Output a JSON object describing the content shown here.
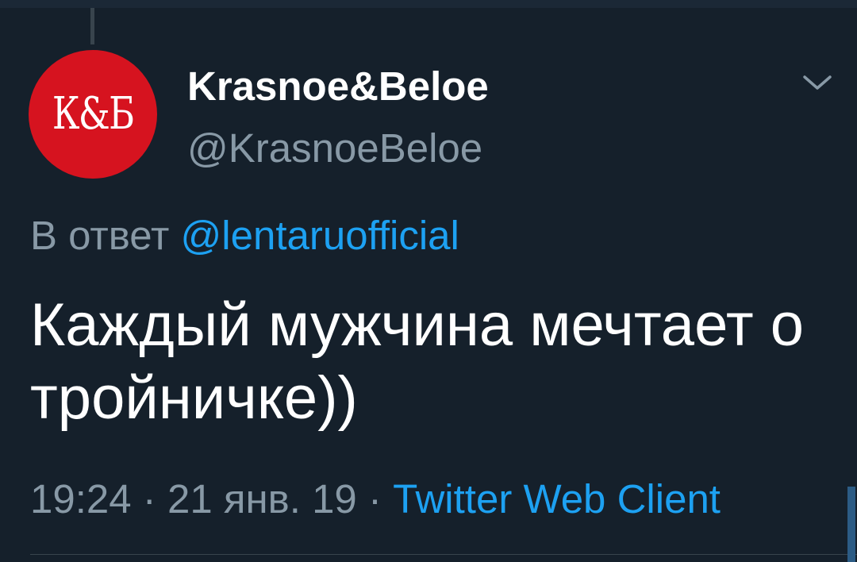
{
  "avatar": {
    "logo_text": "К&Б",
    "background_color": "#d6131f"
  },
  "author": {
    "display_name": "Krasnoe&Beloe",
    "handle": "@KrasnoeBeloe"
  },
  "reply": {
    "prefix": "В ответ",
    "mention": "@lentaruofficial"
  },
  "tweet": {
    "text": "Каждый мужчина мечтает о тройничке))"
  },
  "meta": {
    "time": "19:24",
    "date": "21 янв. 19",
    "separator": "·",
    "source": "Twitter Web Client"
  },
  "icons": {
    "menu": "chevron-down-icon"
  },
  "colors": {
    "background": "#15202b",
    "text_primary": "#ffffff",
    "text_secondary": "#8899a6",
    "link": "#1da1f2"
  }
}
